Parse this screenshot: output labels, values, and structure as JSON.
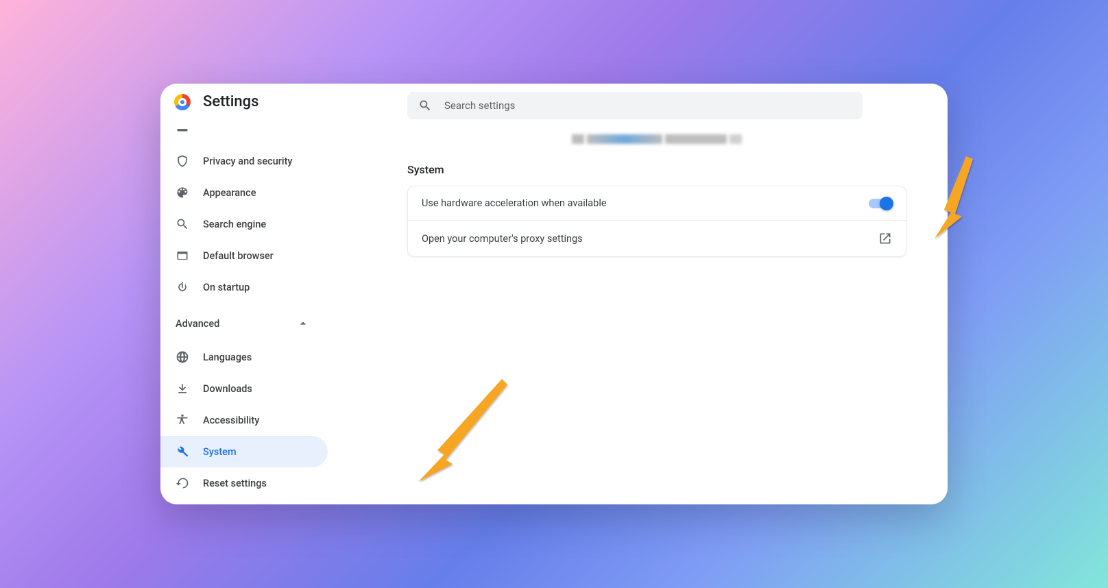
{
  "header": {
    "title": "Settings",
    "search_placeholder": "Search settings"
  },
  "sidebar": {
    "items": [
      {
        "id": "autofill-partial",
        "label": ""
      },
      {
        "id": "privacy",
        "label": "Privacy and security"
      },
      {
        "id": "appearance",
        "label": "Appearance"
      },
      {
        "id": "search-engine",
        "label": "Search engine"
      },
      {
        "id": "default-browser",
        "label": "Default browser"
      },
      {
        "id": "on-startup",
        "label": "On startup"
      }
    ],
    "advanced_label": "Advanced",
    "advanced_expanded": true,
    "advanced_items": [
      {
        "id": "languages",
        "label": "Languages"
      },
      {
        "id": "downloads",
        "label": "Downloads"
      },
      {
        "id": "accessibility",
        "label": "Accessibility"
      },
      {
        "id": "system",
        "label": "System",
        "active": true
      },
      {
        "id": "reset",
        "label": "Reset settings"
      }
    ]
  },
  "main": {
    "section_title": "System",
    "rows": [
      {
        "label": "Use hardware acceleration when available",
        "type": "toggle",
        "value": true
      },
      {
        "label": "Open your computer's proxy settings",
        "type": "external"
      }
    ]
  },
  "annotations": {
    "arrow_color": "#f6a623"
  }
}
